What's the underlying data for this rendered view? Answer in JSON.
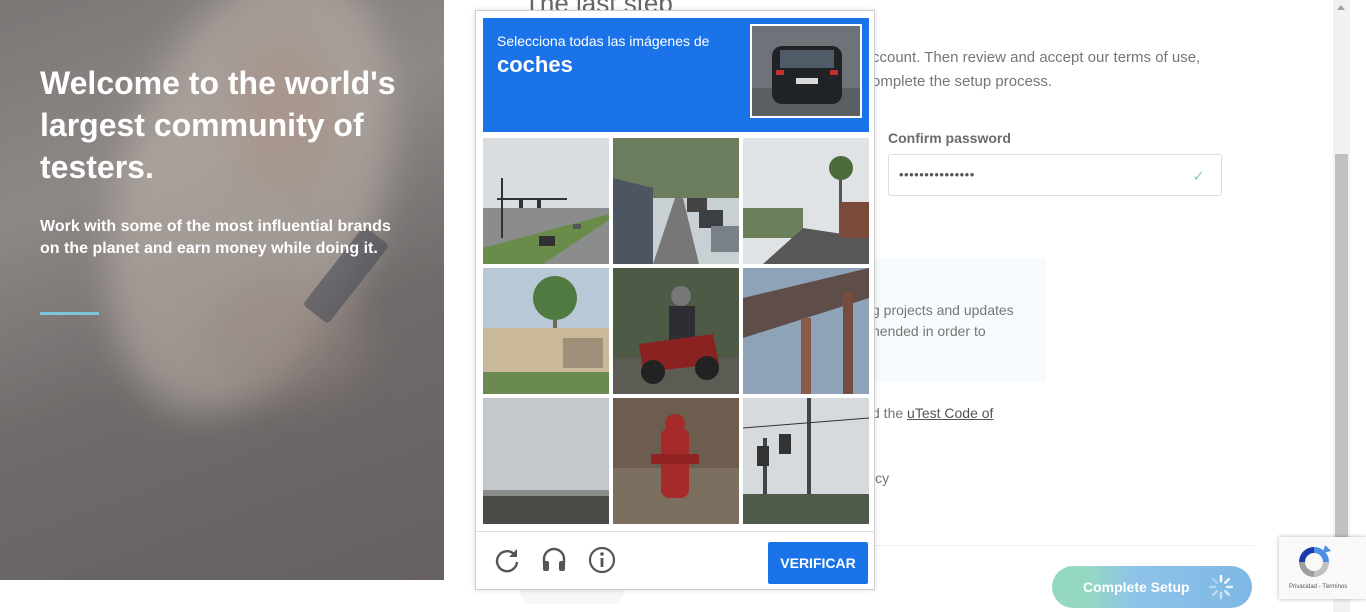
{
  "hero": {
    "heading": "Welcome to the world's largest community of testers.",
    "subtext": "Work with some of the most influential brands on the planet and earn money while doing it."
  },
  "form": {
    "title": "The last step",
    "description": "ccount. Then review and accept our terms of use, omplete the setup process.",
    "confirm_password_label": "Confirm password",
    "confirm_password_value": "•••••••••••••••",
    "info_text": "g projects and updates nended in order to",
    "code_prefix": "d the ",
    "code_link": "uTest Code of",
    "policy_text": "icy",
    "complete_setup_label": "Complete Setup"
  },
  "captcha": {
    "instruction": "Selecciona todas las imágenes de",
    "target": "coches",
    "verify_label": "VERIFICAR",
    "tiles": [
      {
        "desc": "road with traffic lights and car"
      },
      {
        "desc": "street with parked cars"
      },
      {
        "desc": "road with palm trees"
      },
      {
        "desc": "palm trees and building"
      },
      {
        "desc": "motorcycle rider"
      },
      {
        "desc": "overpass structure"
      },
      {
        "desc": "cloudy sky"
      },
      {
        "desc": "red fire hydrant"
      },
      {
        "desc": "traffic lights on pole"
      }
    ],
    "icons": [
      "reload-icon",
      "audio-icon",
      "info-icon"
    ]
  },
  "recaptcha_badge": {
    "legal": "Privacidad - Términos"
  },
  "colors": {
    "captcha_blue": "#1a73e8",
    "hero_accent": "#7fc4dd",
    "check_green": "#88d1b4"
  }
}
